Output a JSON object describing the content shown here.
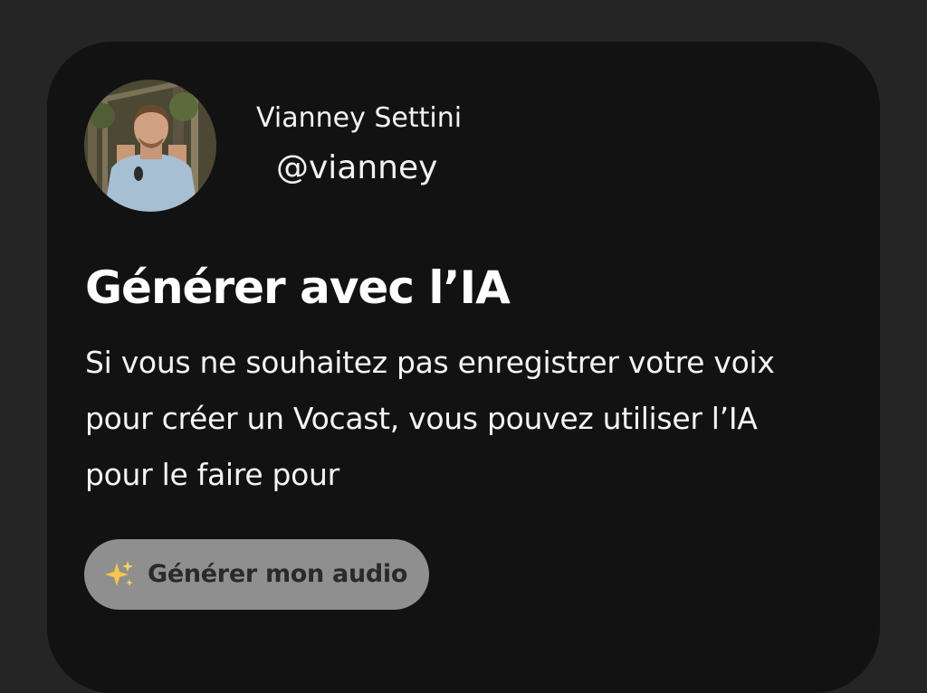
{
  "profile": {
    "name": "Vianney Settini",
    "handle": "@vianney",
    "avatar_icon": "user-photo"
  },
  "section": {
    "title": "Générer avec l’IA",
    "description": "Si vous ne souhaitez pas enregistrer votre voix pour créer un Vocast, vous pouvez utiliser l’IA pour le faire pour"
  },
  "action": {
    "label": "Générer mon audio",
    "icon": "sparkles-icon"
  },
  "colors": {
    "page_background": "#252525",
    "card_background": "#121212",
    "button_background": "#8f8f8f",
    "button_text": "#2a2a2a",
    "text": "#ffffff",
    "sparkle": "#f5c64a"
  }
}
